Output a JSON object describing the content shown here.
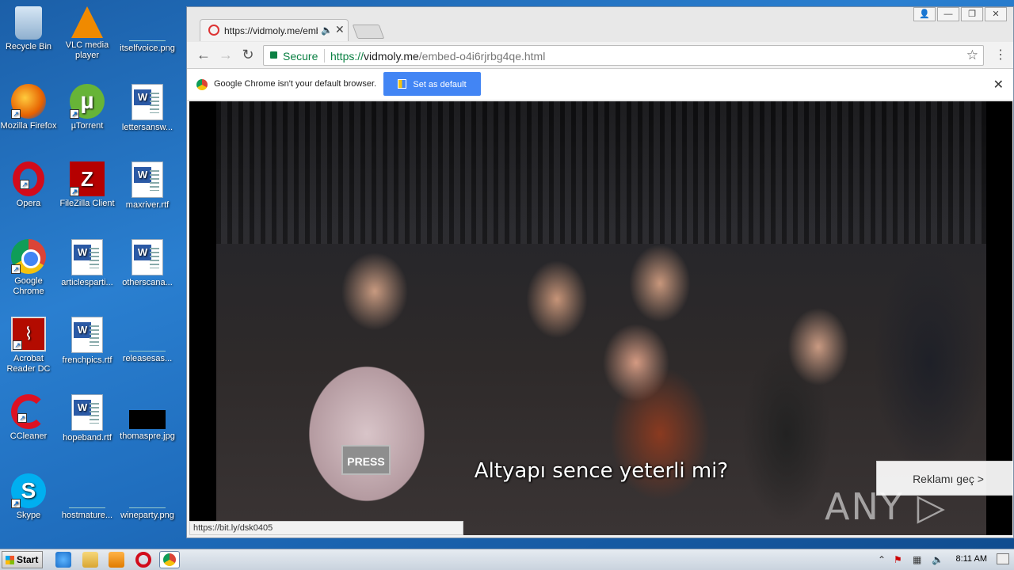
{
  "desktop": {
    "icons": [
      {
        "label": "Recycle Bin",
        "icon": "recycle-bin-icon"
      },
      {
        "label": "VLC media player",
        "icon": "vlc-icon"
      },
      {
        "label": "itselfvoice.png",
        "icon": "image-file-icon"
      },
      {
        "label": "Mozilla Firefox",
        "icon": "firefox-icon"
      },
      {
        "label": "µTorrent",
        "icon": "utorrent-icon"
      },
      {
        "label": "lettersansw...",
        "icon": "word-doc-icon"
      },
      {
        "label": "Opera",
        "icon": "opera-icon"
      },
      {
        "label": "FileZilla Client",
        "icon": "filezilla-icon"
      },
      {
        "label": "maxriver.rtf",
        "icon": "word-doc-icon"
      },
      {
        "label": "Google Chrome",
        "icon": "chrome-icon"
      },
      {
        "label": "articlesparti...",
        "icon": "word-doc-icon"
      },
      {
        "label": "otherscana...",
        "icon": "word-doc-icon"
      },
      {
        "label": "Acrobat Reader DC",
        "icon": "acrobat-icon"
      },
      {
        "label": "frenchpics.rtf",
        "icon": "word-doc-icon"
      },
      {
        "label": "releasesas...",
        "icon": "image-file-icon"
      },
      {
        "label": "CCleaner",
        "icon": "ccleaner-icon"
      },
      {
        "label": "hopeband.rtf",
        "icon": "word-doc-icon"
      },
      {
        "label": "thomaspre.jpg",
        "icon": "image-file-icon"
      },
      {
        "label": "Skype",
        "icon": "skype-icon"
      },
      {
        "label": "hostmature...",
        "icon": "image-file-icon"
      },
      {
        "label": "wineparty.png",
        "icon": "image-file-icon"
      }
    ]
  },
  "browser": {
    "tab_title": "https://vidmoly.me/emb",
    "tab_audio_icon": "🔈",
    "tab_close": "✕",
    "window_buttons": {
      "user": "👤",
      "minimize": "—",
      "restore": "❐",
      "close": "✕"
    },
    "nav": {
      "back": "←",
      "forward": "→",
      "reload": "↻"
    },
    "omnibox": {
      "secure_label": "Secure",
      "url_proto": "https://",
      "url_host": "vidmoly.me",
      "url_path": "/embed-o4i6rjrbg4qe.html"
    },
    "bookmark_star": "☆",
    "menu": "⋮",
    "infobar": {
      "message": "Google Chrome isn't your default browser.",
      "button_label": "Set as default",
      "close": "✕"
    }
  },
  "video": {
    "subtitle": "Altyapı sence yeterli mi?",
    "press_badge": "PRESS",
    "skip_ad_label": "Reklamı geç >",
    "watermark": "ANY ▷ RUN",
    "status_url": "https://bit.ly/dsk0405"
  },
  "taskbar": {
    "start_label": "Start",
    "clock": "8:11 AM",
    "tray_expand": "⌃"
  }
}
